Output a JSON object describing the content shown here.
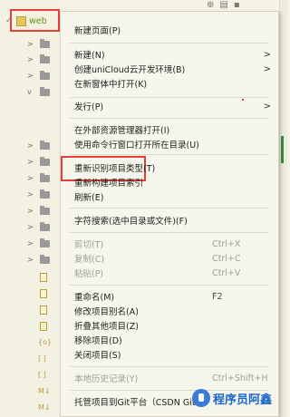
{
  "tree": {
    "project_label": "web"
  },
  "menu": {
    "items": [
      {
        "label": "新建页面(P)"
      },
      {
        "label": "新建(N)"
      },
      {
        "label": "创建uniCloud云开发环境(B)"
      },
      {
        "label": "在新窗体中打开(K)"
      },
      {
        "label": "发行(P)"
      },
      {
        "label": "在外部资源管理器打开(I)"
      },
      {
        "label": "使用命令行窗口打开所在目录(U)"
      },
      {
        "label": "重新识别项目类型(T)"
      },
      {
        "label": "重新构建项目索引"
      },
      {
        "label": "刷新(E)"
      },
      {
        "label": "字符搜索(选中目录或文件)(F)"
      },
      {
        "label": "剪切(T)",
        "shortcut": "Ctrl+X"
      },
      {
        "label": "复制(C)",
        "shortcut": "Ctrl+C"
      },
      {
        "label": "粘贴(P)",
        "shortcut": "Ctrl+V"
      },
      {
        "label": "重命名(M)",
        "shortcut": "F2"
      },
      {
        "label": "修改项目别名(A)"
      },
      {
        "label": "折叠其他项目(Z)"
      },
      {
        "label": "移除项目(D)"
      },
      {
        "label": "关闭项目(S)"
      },
      {
        "label": "本地历史记录(Y)",
        "shortcut": "Ctrl+Shift+H"
      },
      {
        "label": "托管项目到Git平台（CSDN GitC"
      }
    ]
  },
  "watermark": {
    "text": "程序员阿鑫"
  }
}
